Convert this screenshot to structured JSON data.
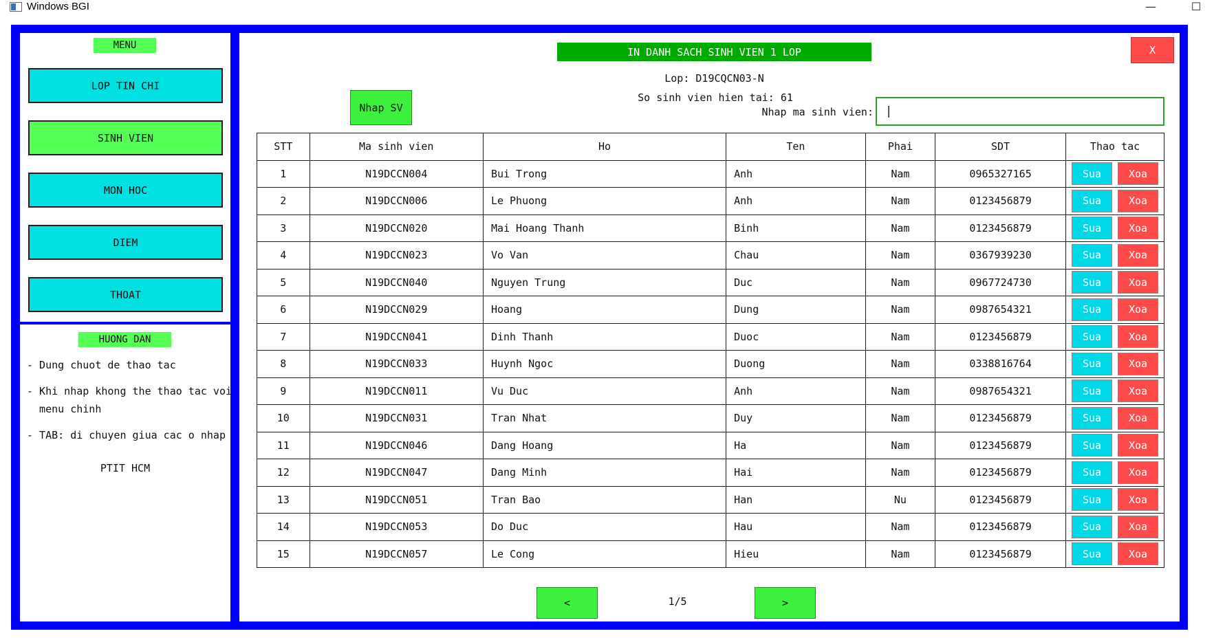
{
  "window": {
    "title": "Windows BGI",
    "minimize": "—",
    "maximize": "☐"
  },
  "menu": {
    "label": "MENU",
    "items": [
      {
        "label": "LOP TIN CHI",
        "active": false
      },
      {
        "label": "SINH VIEN",
        "active": true
      },
      {
        "label": "MON HOC",
        "active": false
      },
      {
        "label": "DIEM",
        "active": false
      },
      {
        "label": "THOAT",
        "active": false
      }
    ]
  },
  "guide": {
    "label": "HUONG DAN",
    "lines": [
      "- Dung chuot de thao tac",
      "- Khi nhap khong the thao tac voi",
      "  menu chinh",
      "- TAB: di chuyen giua cac o nhap"
    ],
    "footer": "PTIT HCM"
  },
  "main": {
    "title": "IN DANH SACH SINH VIEN 1 LOP",
    "close_label": "X",
    "class_info": "Lop: D19CQCN03-N",
    "count_info": "So sinh vien hien tai: 61",
    "add_button": "Nhap SV",
    "search_label": "Nhap ma sinh vien:",
    "search_value": "|",
    "columns": [
      "STT",
      "Ma sinh vien",
      "Ho",
      "Ten",
      "Phai",
      "SDT",
      "Thao tac"
    ],
    "edit_label": "Sua",
    "delete_label": "Xoa",
    "rows": [
      [
        "1",
        "N19DCCN004",
        "Bui Trong",
        "Anh",
        "Nam",
        "0965327165"
      ],
      [
        "2",
        "N19DCCN006",
        "Le Phuong",
        "Anh",
        "Nam",
        "0123456879"
      ],
      [
        "3",
        "N19DCCN020",
        "Mai Hoang Thanh",
        "Binh",
        "Nam",
        "0123456879"
      ],
      [
        "4",
        "N19DCCN023",
        "Vo Van",
        "Chau",
        "Nam",
        "0367939230"
      ],
      [
        "5",
        "N19DCCN040",
        "Nguyen Trung",
        "Duc",
        "Nam",
        "0967724730"
      ],
      [
        "6",
        "N19DCCN029",
        "Hoang",
        "Dung",
        "Nam",
        "0987654321"
      ],
      [
        "7",
        "N19DCCN041",
        "Dinh Thanh",
        "Duoc",
        "Nam",
        "0123456879"
      ],
      [
        "8",
        "N19DCCN033",
        "Huynh Ngoc",
        "Duong",
        "Nam",
        "0338816764"
      ],
      [
        "9",
        "N19DCCN011",
        "Vu Duc",
        "Anh",
        "Nam",
        "0987654321"
      ],
      [
        "10",
        "N19DCCN031",
        "Tran Nhat",
        "Duy",
        "Nam",
        "0123456879"
      ],
      [
        "11",
        "N19DCCN046",
        "Dang Hoang",
        "Ha",
        "Nam",
        "0123456879"
      ],
      [
        "12",
        "N19DCCN047",
        "Dang Minh",
        "Hai",
        "Nam",
        "0123456879"
      ],
      [
        "13",
        "N19DCCN051",
        "Tran Bao",
        "Han",
        "Nu",
        "0123456879"
      ],
      [
        "14",
        "N19DCCN053",
        "Do Duc",
        "Hau",
        "Nam",
        "0123456879"
      ],
      [
        "15",
        "N19DCCN057",
        "Le Cong",
        "Hieu",
        "Nam",
        "0123456879"
      ]
    ],
    "pagination": {
      "prev": "<",
      "page": "1/5",
      "next": ">"
    }
  }
}
